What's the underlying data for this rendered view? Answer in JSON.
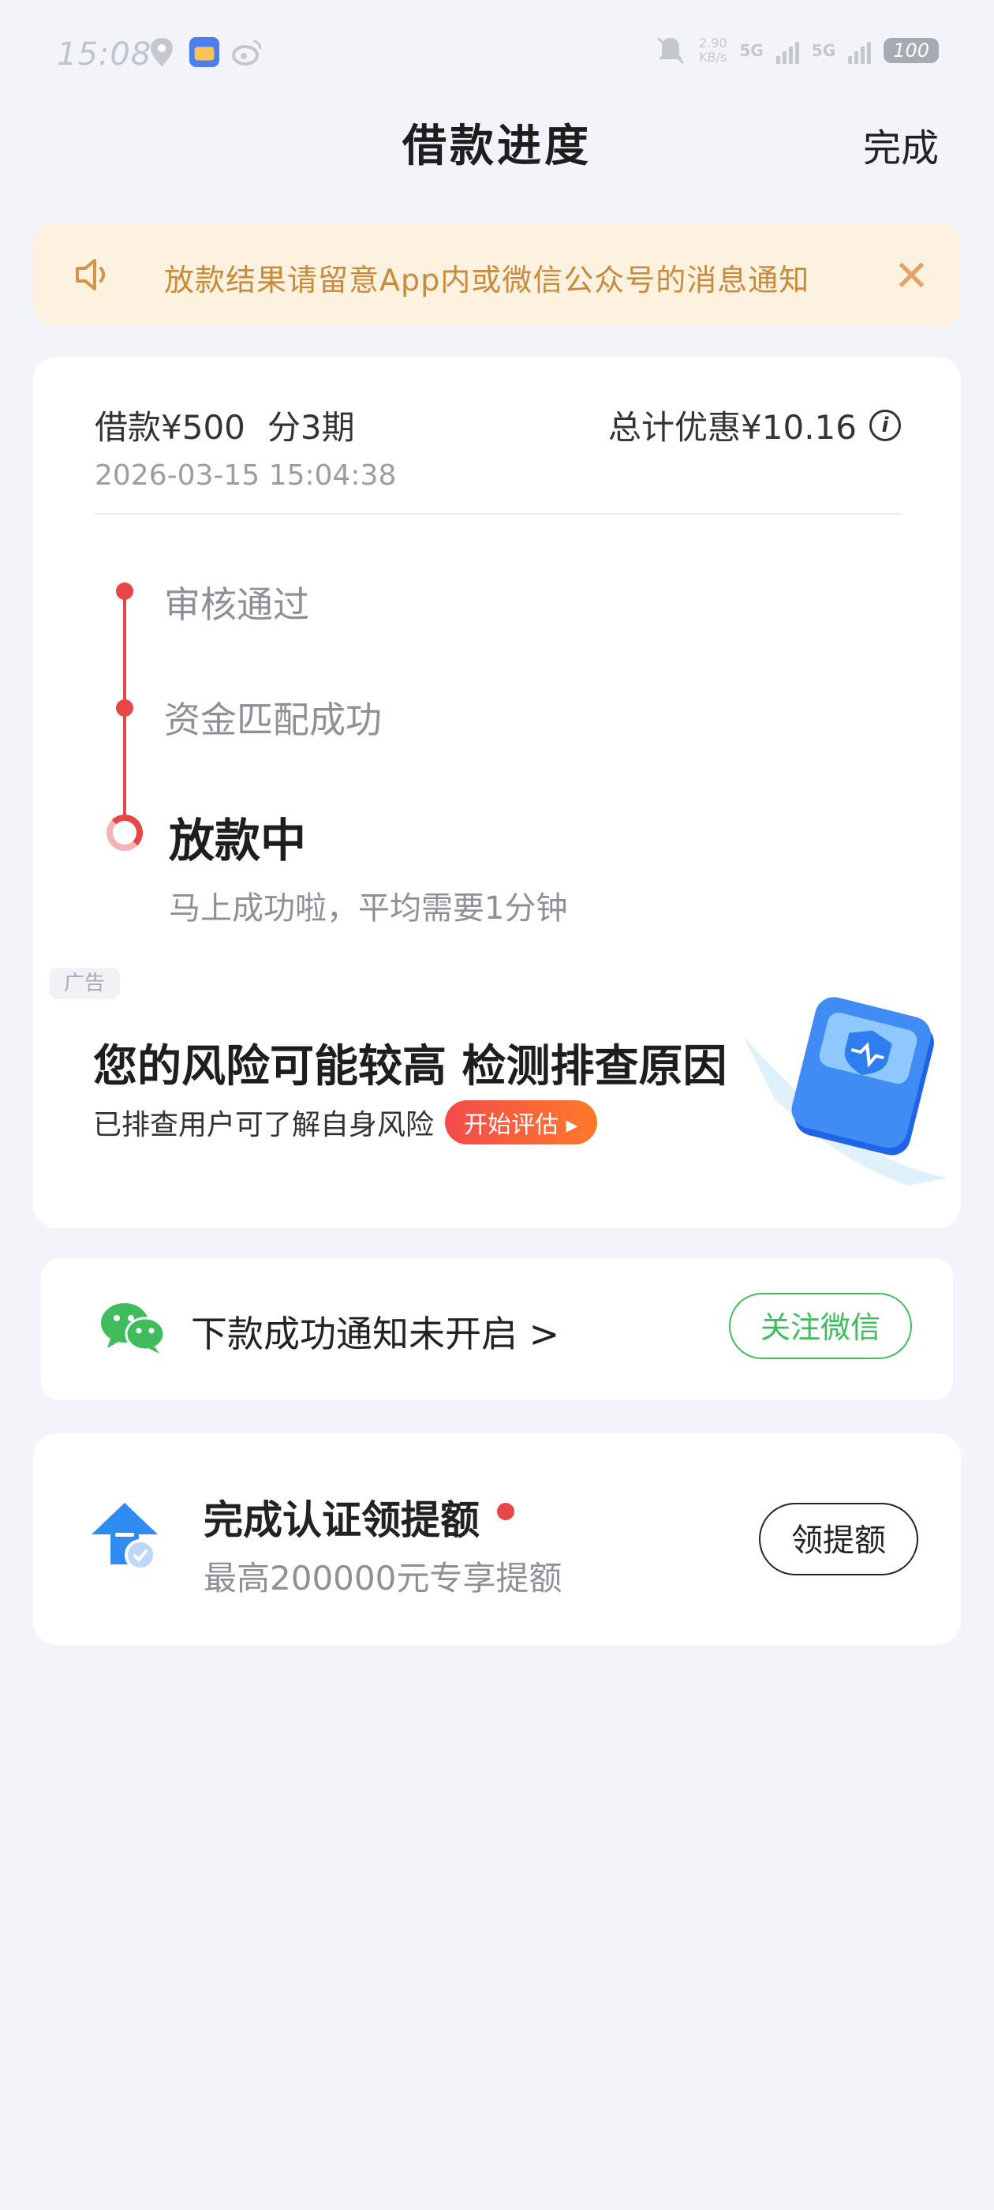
{
  "status_bar": {
    "time": "15:08",
    "speed_value": "2.90",
    "speed_unit": "KB/s",
    "network_1": "5G",
    "network_2": "5G",
    "battery": "100"
  },
  "header": {
    "title": "借款进度",
    "done_label": "完成"
  },
  "notice": {
    "text": "放款结果请留意App内或微信公众号的消息通知",
    "close_glyph": "✕",
    "color": "#c98a3c"
  },
  "loan": {
    "amount": "借款¥500",
    "periods": "分3期",
    "date": "2026-03-15 15:04:38",
    "discount": "总计优惠¥10.16",
    "info_glyph": "i"
  },
  "timeline": {
    "steps": [
      {
        "label": "审核通过"
      },
      {
        "label": "资金匹配成功"
      }
    ],
    "current": {
      "label": "放款中",
      "desc": "马上成功啦，平均需要1分钟"
    },
    "accent": "#e94646"
  },
  "ad": {
    "badge": "广告",
    "title": "您的风险可能较高 检测排查原因",
    "subtitle": "已排查用户可了解自身风险",
    "button": "开始评估"
  },
  "wechat": {
    "text": "下款成功通知未开启 >",
    "button": "关注微信",
    "color": "#3fbd5d"
  },
  "quota": {
    "title": "完成认证领提额",
    "subtitle": "最高200000元专享提额",
    "button": "领提额"
  }
}
